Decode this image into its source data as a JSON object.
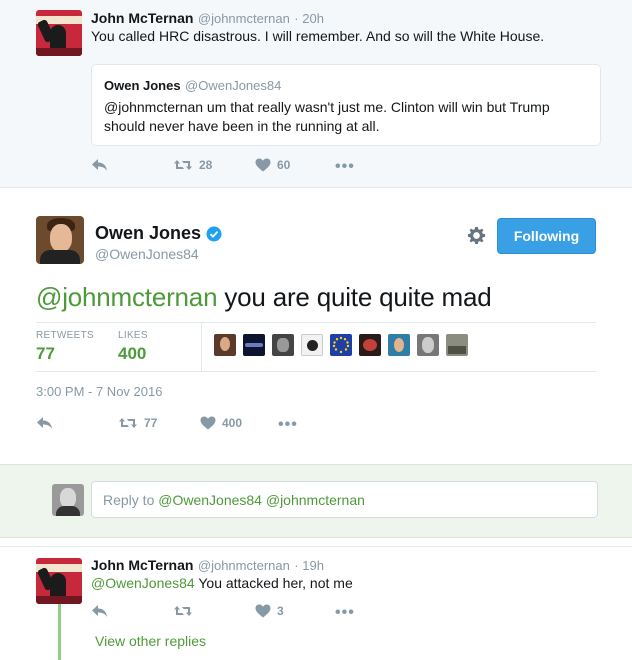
{
  "top_tweet": {
    "name": "John McTernan",
    "handle": "@johnmcternan",
    "time": "· 20h",
    "text": "You called HRC disastrous. I will remember. And so will the White House.",
    "quoted": {
      "name": "Owen Jones",
      "handle": "@OwenJones84",
      "line1": "@johnmcternan um that really wasn't just me. Clinton will win but Trump",
      "line2": "should never have been in the running at all."
    },
    "retweets": "28",
    "likes": "60"
  },
  "main_tweet": {
    "name": "Owen Jones",
    "handle": "@OwenJones84",
    "follow_label": "Following",
    "mention": "@johnmcternan",
    "text": " you are quite quite mad",
    "retweets_label": "RETWEETS",
    "retweets_value": "77",
    "likes_label": "LIKES",
    "likes_value": "400",
    "timestamp": "3:00 PM - 7 Nov 2016",
    "action_retweets": "77",
    "action_likes": "400"
  },
  "reply_box": {
    "placeholder_prefix": "Reply to ",
    "placeholder_mentions": "@OwenJones84 @johnmcternan"
  },
  "reply_tweet": {
    "name": "John McTernan",
    "handle": "@johnmcternan",
    "time": "· 19h",
    "mention": "@OwenJones84",
    "text": " You attacked her, not me",
    "likes": "3",
    "view_other": "View other replies"
  },
  "colors": {
    "accent_green": "#4e9a3a",
    "follow_blue": "#3aa0e6",
    "verified_blue": "#1da1f2"
  }
}
